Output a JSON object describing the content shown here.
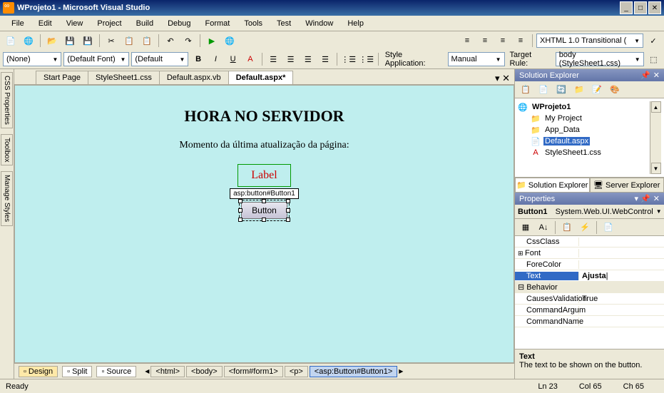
{
  "titlebar": {
    "title": "WProjeto1 - Microsoft Visual Studio"
  },
  "menu": [
    "File",
    "Edit",
    "View",
    "Project",
    "Build",
    "Debug",
    "Format",
    "Tools",
    "Test",
    "Window",
    "Help"
  ],
  "toolbar_row2": {
    "style_dropdown": "(None)",
    "font_dropdown": "(Default Font)",
    "size_dropdown": "(Default",
    "style_app_label": "Style Application:",
    "style_app_value": "Manual",
    "target_rule_label": "Target Rule:",
    "target_rule_value": "body (StyleSheet1.css)",
    "doctype_value": "XHTML 1.0 Transitional ("
  },
  "doctabs": [
    {
      "label": "Start Page",
      "active": false
    },
    {
      "label": "StyleSheet1.css",
      "active": false
    },
    {
      "label": "Default.aspx.vb",
      "active": false
    },
    {
      "label": "Default.aspx*",
      "active": true
    }
  ],
  "left_tabs": [
    "CSS Properties",
    "Toolbox",
    "Manage Styles"
  ],
  "page": {
    "heading": "HORA NO SERVIDOR",
    "subtext": "Momento da última atualização da página:",
    "label_text": "Label",
    "tag_label": "asp:button#Button1",
    "button_text": "Button"
  },
  "design_buttons": [
    "Design",
    "Split",
    "Source"
  ],
  "breadcrumb": [
    "<html>",
    "<body>",
    "<form#form1>",
    "<p>",
    "<asp:Button#Button1>"
  ],
  "solution": {
    "title": "Solution Explorer",
    "root": "WProjeto1",
    "items": [
      {
        "label": "My Project",
        "icon": "folder-icon"
      },
      {
        "label": "App_Data",
        "icon": "folder-icon"
      },
      {
        "label": "Default.aspx",
        "icon": "aspx-icon",
        "selected": true
      },
      {
        "label": "StyleSheet1.css",
        "icon": "css-icon"
      }
    ],
    "bottom_tabs": [
      "Solution Explorer",
      "Server Explorer"
    ]
  },
  "properties": {
    "title": "Properties",
    "object": "Button1",
    "object_type": "System.Web.UI.WebControl",
    "rows": [
      {
        "name": "CssClass",
        "value": ""
      },
      {
        "name": "Font",
        "value": "",
        "expandable": true
      },
      {
        "name": "ForeColor",
        "value": ""
      },
      {
        "name": "Text",
        "value": "Ajusta",
        "selected": true
      }
    ],
    "category": "Behavior",
    "rows2": [
      {
        "name": "CausesValidation",
        "value": "True"
      },
      {
        "name": "CommandArgum",
        "value": ""
      },
      {
        "name": "CommandName",
        "value": ""
      }
    ],
    "help_name": "Text",
    "help_desc": "The text to be shown on the button."
  },
  "status": {
    "ready": "Ready",
    "ln": "Ln 23",
    "col": "Col 65",
    "ch": "Ch 65"
  }
}
